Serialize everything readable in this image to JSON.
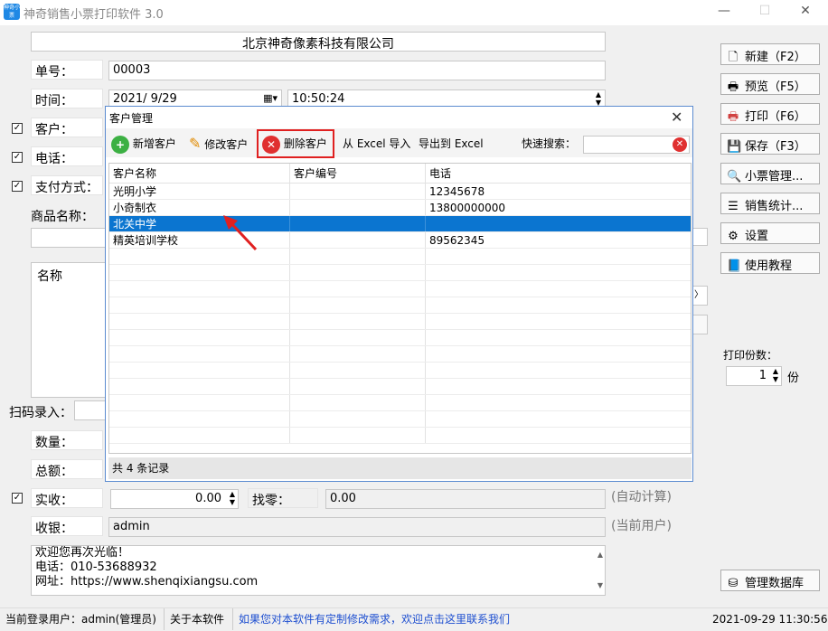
{
  "window": {
    "title": "神奇销售小票打印软件 3.0",
    "icon_text": "神奇小票",
    "minimize": "—",
    "maximize": "☐",
    "close": "✕"
  },
  "form": {
    "company": "北京神奇像素科技有限公司",
    "order_no_label": "单号：",
    "order_no": "00003",
    "time_label": "时间：",
    "date": "2021/ 9/29",
    "time": "10:50:24",
    "customer_label": "客户：",
    "phone_label": "电话：",
    "payment_label": "支付方式：",
    "product_label": "商品名称：",
    "list_header": "名称",
    "scan_label": "扫码录入：",
    "qty_label": "数量：",
    "total_label": "总额：",
    "paid_label": "实收：",
    "paid_value": "0.00",
    "change_label": "找零：",
    "change_value": "0.00",
    "auto_calc": "(自动计算)",
    "cashier_label": "收银：",
    "cashier_value": "admin",
    "current_user": "(当前用户)",
    "footer_lines": [
      "欢迎您再次光临！",
      "电话：010-53688932",
      "网址：https://www.shenqixiangsu.com"
    ]
  },
  "sidebar": {
    "buttons": [
      {
        "icon": "new-doc-icon",
        "glyph": "🗋",
        "label": "新建（F2）"
      },
      {
        "icon": "preview-icon",
        "glyph": "🖶",
        "label": "预览（F5）"
      },
      {
        "icon": "print-icon",
        "glyph": "🖶",
        "label": "打印（F6）"
      },
      {
        "icon": "save-icon",
        "glyph": "💾",
        "label": "保存（F3）"
      },
      {
        "icon": "search-icon",
        "glyph": "🔍",
        "label": "小票管理..."
      },
      {
        "icon": "stats-icon",
        "glyph": "☰",
        "label": "销售统计..."
      },
      {
        "icon": "gear-icon",
        "glyph": "⚙",
        "label": "设置"
      },
      {
        "icon": "book-icon",
        "glyph": "📘",
        "label": "使用教程"
      }
    ],
    "copies_label": "打印份数：",
    "copies_value": "1",
    "copies_unit": "份",
    "db_button": "管理数据库"
  },
  "dialog": {
    "title": "客户管理",
    "close": "✕",
    "toolbar": {
      "add": "新增客户",
      "edit": "修改客户",
      "delete": "删除客户",
      "import": "从 Excel 导入",
      "export": "导出到 Excel",
      "search_label": "快速搜索："
    },
    "columns": [
      "客户名称",
      "客户编号",
      "电话"
    ],
    "rows": [
      {
        "name": "光明小学",
        "code": "",
        "phone": "12345678"
      },
      {
        "name": "小奇制衣",
        "code": "",
        "phone": "13800000000"
      },
      {
        "name": "北关中学",
        "code": "",
        "phone": ""
      },
      {
        "name": "精英培训学校",
        "code": "",
        "phone": "89562345"
      }
    ],
    "selected_row": 2,
    "status": "共 4 条记录",
    "highlight_color": "#e02020",
    "selection_color": "#0b75d0"
  },
  "statusbar": {
    "user": "当前登录用户：admin(管理员)",
    "about": "关于本软件",
    "custom_link": "如果您对本软件有定制修改需求，欢迎点击这里联系我们",
    "datetime": "2021-09-29 11:30:56"
  }
}
